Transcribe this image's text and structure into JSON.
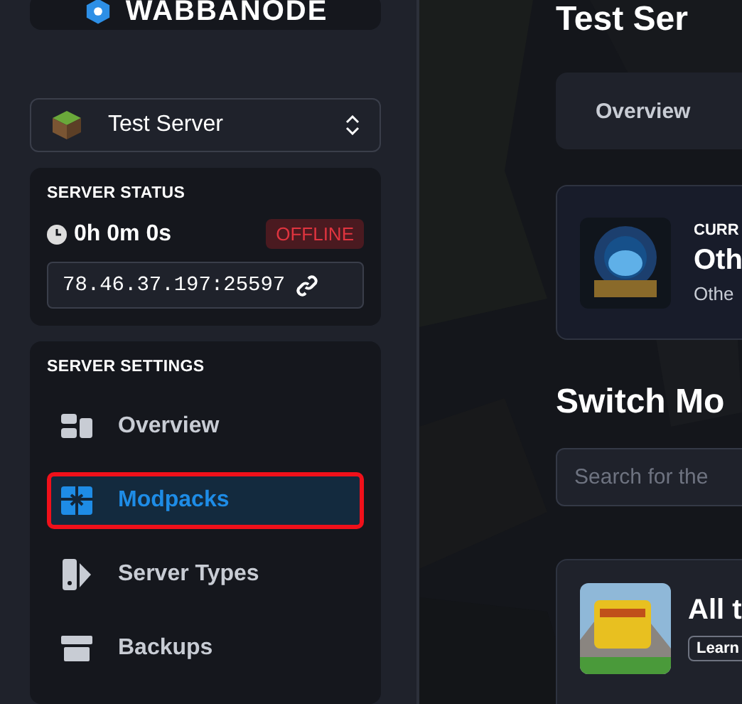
{
  "sidebar": {
    "logo": "WABBANODE",
    "server_select": {
      "label": "Test Server"
    },
    "status": {
      "heading": "SERVER STATUS",
      "uptime": "0h 0m 0s",
      "state": "OFFLINE",
      "address": "78.46.37.197:25597"
    },
    "settings": {
      "heading": "SERVER SETTINGS",
      "items": [
        {
          "label": "Overview",
          "kind": "overview",
          "selected": false
        },
        {
          "label": "Modpacks",
          "kind": "modpacks",
          "selected": true
        },
        {
          "label": "Server Types",
          "kind": "types",
          "selected": false
        },
        {
          "label": "Backups",
          "kind": "backups",
          "selected": false
        }
      ]
    }
  },
  "main": {
    "title": "Test Ser",
    "tabs": [
      {
        "label": "Overview",
        "selected": false
      }
    ],
    "current": {
      "eyebrow": "CURR",
      "name": "Oth",
      "subtitle": "Othe"
    },
    "switch_heading": "Switch Mo",
    "search": {
      "placeholder": "Search for the"
    },
    "modpacks": [
      {
        "name": "All t",
        "badge": "Learn"
      }
    ]
  }
}
